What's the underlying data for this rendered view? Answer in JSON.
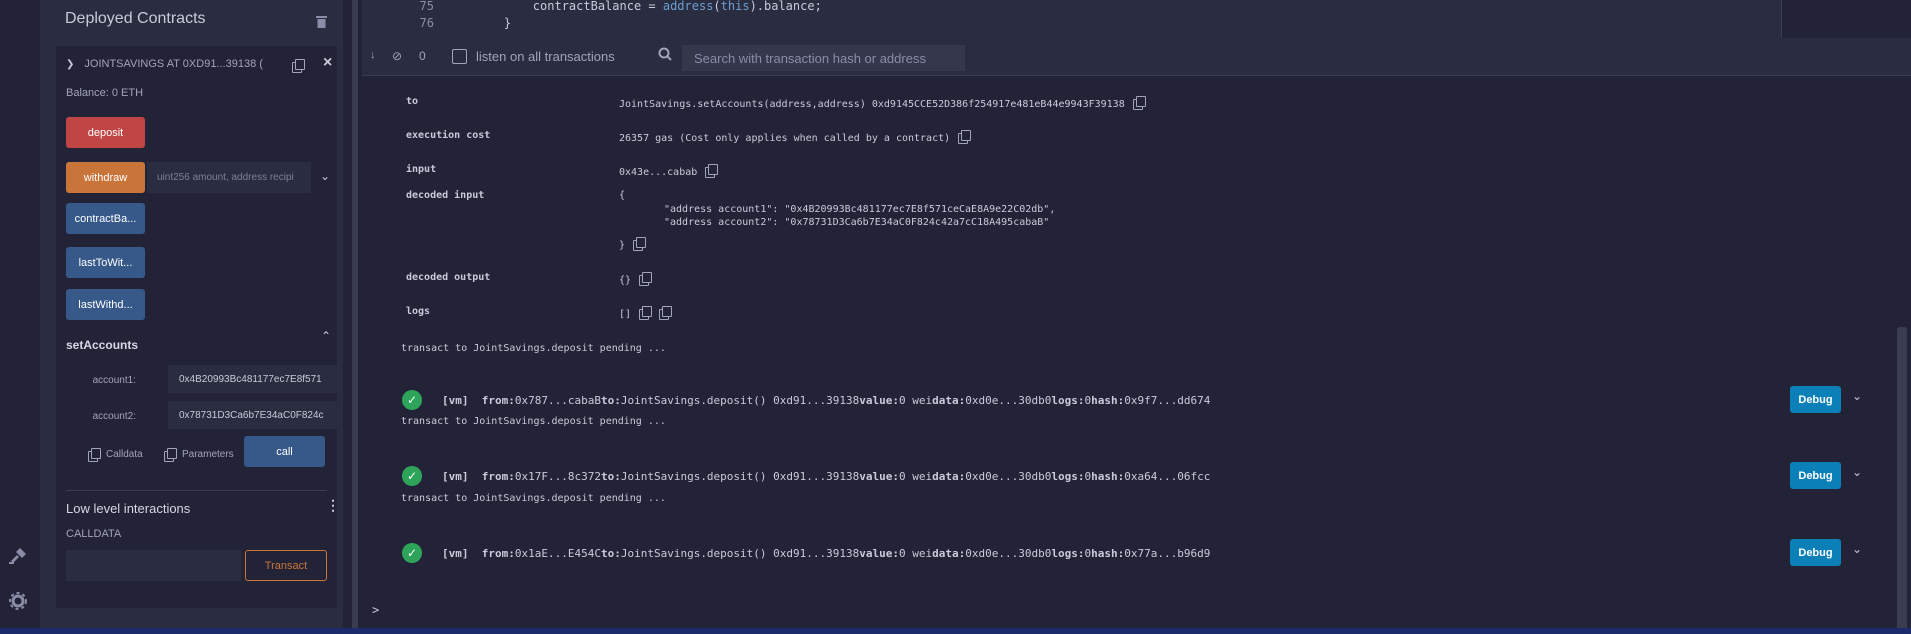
{
  "rail": {
    "icons": [
      "plug-icon",
      "gear-icon"
    ]
  },
  "panel": {
    "title": "Deployed Contracts",
    "contract": {
      "header": "JOINTSAVINGS AT 0XD91...39138 (",
      "balance": "Balance: 0 ETH",
      "deposit_label": "deposit",
      "withdraw_label": "withdraw",
      "withdraw_placeholder": "uint256 amount, address recipi",
      "contract_balance_label": "contractBa...",
      "last_to_withdraw_label": "lastToWit...",
      "last_withdraw_label": "lastWithd...",
      "set_accounts": {
        "title": "setAccounts",
        "account1_label": "account1:",
        "account1_value": "0x4B20993Bc481177ec7E8f571",
        "account2_label": "account2:",
        "account2_value": "0x78731D3Ca6b7E34aC0F824c",
        "calldata_label": "Calldata",
        "parameters_label": "Parameters",
        "call_label": "call"
      },
      "low_level": {
        "title": "Low level interactions",
        "calldata_label": "CALLDATA",
        "transact_label": "Transact"
      }
    }
  },
  "editor": {
    "lines": [
      {
        "no": "75",
        "pre": "        contractBalance = ",
        "kw1": "address",
        "mid": "(",
        "kw2": "this",
        "post": ").balance;"
      },
      {
        "no": "76",
        "pre": "    }",
        "kw1": "",
        "mid": "",
        "kw2": "",
        "post": ""
      }
    ]
  },
  "terminal_bar": {
    "count": "0",
    "listen_label": "listen on all transactions",
    "search_placeholder": "Search with transaction hash or address"
  },
  "details": {
    "to_key": "to",
    "to_value": "JointSavings.setAccounts(address,address) 0xd9145CCE52D386f254917e481eB44e9943F39138",
    "exec_key": "execution cost",
    "exec_value": "26357 gas (Cost only applies when called by a contract)",
    "input_key": "input",
    "input_value": "0x43e...cabab",
    "decoded_input_key": "decoded input",
    "decoded_input_open": "{",
    "decoded_input_line1": "\"address account1\": \"0x4B20993Bc481177ec7E8f571ceCaE8A9e22C02db\",",
    "decoded_input_line2": "\"address account2\": \"0x78731D3Ca6b7E34aC0F824c42a7cC18A495cabaB\"",
    "decoded_input_close": "}",
    "decoded_output_key": "decoded output",
    "decoded_output_value": "{}",
    "logs_key": "logs",
    "logs_value": "[]"
  },
  "log": [
    {
      "kind": "pending",
      "text": "transact to JointSavings.deposit pending ..."
    },
    {
      "kind": "tx",
      "vm": "[vm]",
      "from_label": "from:",
      "from": "0x787...cabaB",
      "to_label": "to:",
      "to": "JointSavings.deposit() 0xd91...39138",
      "value_label": "value:",
      "value": "0 wei",
      "data_label": "data:",
      "data": "0xd0e...30db0",
      "logs_label": "logs:",
      "logs": "0",
      "hash_label": "hash:",
      "hash": "0x9f7...dd674",
      "debug": "Debug"
    },
    {
      "kind": "pending",
      "text": "transact to JointSavings.deposit pending ..."
    },
    {
      "kind": "tx",
      "vm": "[vm]",
      "from_label": "from:",
      "from": "0x17F...8c372",
      "to_label": "to:",
      "to": "JointSavings.deposit() 0xd91...39138",
      "value_label": "value:",
      "value": "0 wei",
      "data_label": "data:",
      "data": "0xd0e...30db0",
      "logs_label": "logs:",
      "logs": "0",
      "hash_label": "hash:",
      "hash": "0xa64...06fcc",
      "debug": "Debug"
    },
    {
      "kind": "pending",
      "text": "transact to JointSavings.deposit pending ..."
    },
    {
      "kind": "tx",
      "vm": "[vm]",
      "from_label": "from:",
      "from": "0x1aE...E454C",
      "to_label": "to:",
      "to": "JointSavings.deposit() 0xd91...39138",
      "value_label": "value:",
      "value": "0 wei",
      "data_label": "data:",
      "data": "0xd0e...30db0",
      "logs_label": "logs:",
      "logs": "0",
      "hash_label": "hash:",
      "hash": "0x77a...b96d9",
      "debug": "Debug"
    }
  ],
  "prompt": ">",
  "colors": {
    "deposit": "#c04545",
    "withdraw": "#c97539",
    "call": "#36598a",
    "debug": "#0b7fb8",
    "success": "#2ea45a"
  }
}
